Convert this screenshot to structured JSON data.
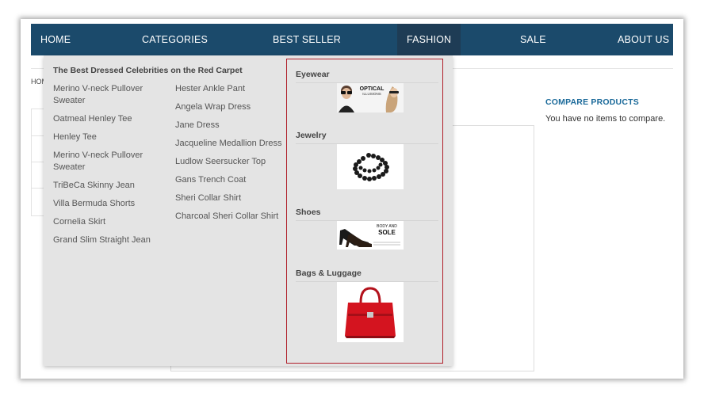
{
  "nav": {
    "items": [
      "HOME",
      "CATEGORIES",
      "BEST SELLER",
      "FASHION",
      "SALE",
      "ABOUT US"
    ]
  },
  "breadcrumb": "HOM",
  "sidebar": {
    "title": "COMPARE PRODUCTS",
    "text": "You have no items to compare."
  },
  "dropdown": {
    "heading": "The Best Dressed Celebrities on the Red Carpet",
    "col1": [
      "Merino V-neck Pullover Sweater",
      "Oatmeal Henley Tee",
      "Henley Tee",
      "Merino V-neck Pullover Sweater",
      "TriBeCa Skinny Jean",
      "Villa Bermuda Shorts",
      "Cornelia Skirt",
      "Grand Slim Straight Jean"
    ],
    "col2": [
      "Hester Ankle Pant",
      "Angela Wrap Dress",
      "Jane Dress",
      "Jacqueline Medallion Dress",
      "Ludlow Seersucker Top",
      "Gans Trench Coat",
      "Sheri Collar Shirt",
      "Charcoal Sheri Collar Shirt"
    ],
    "featured": [
      {
        "title": "Eyewear",
        "banner_line1": "OPTICAL",
        "banner_line2": "ILLUSIONS"
      },
      {
        "title": "Jewelry"
      },
      {
        "title": "Shoes",
        "banner_line1": "BODY AND",
        "banner_line2": "SOLE"
      },
      {
        "title": "Bags & Luggage"
      }
    ]
  },
  "colors": {
    "nav_bg": "#1b4a6b",
    "nav_active": "#1e3c55",
    "highlight_border": "#b01f2a",
    "dropdown_bg": "#e4e4e4",
    "compare_title": "#1b6a9a"
  }
}
